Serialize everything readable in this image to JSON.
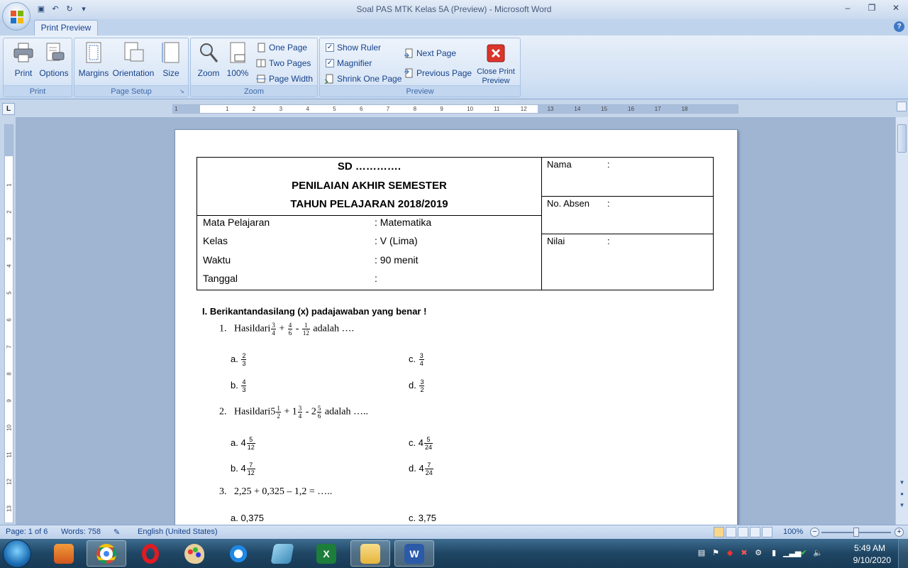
{
  "window": {
    "title": "Soal PAS MTK Kelas 5A (Preview) - Microsoft Word",
    "minimize": "‒",
    "restore": "❐",
    "close": "✕"
  },
  "qat": {
    "save": "▣",
    "undo": "↶",
    "redo": "↻",
    "customize": "▾"
  },
  "tabs": {
    "active": "Print Preview",
    "help": "?"
  },
  "ribbon": {
    "print_group": {
      "label": "Print",
      "print": "Print",
      "options": "Options"
    },
    "page_setup_group": {
      "label": "Page Setup",
      "margins": "Margins",
      "orientation": "Orientation",
      "size": "Size"
    },
    "zoom_group": {
      "label": "Zoom",
      "zoom": "Zoom",
      "zoom100": "100%",
      "one_page": "One Page",
      "two_pages": "Two Pages",
      "page_width": "Page Width"
    },
    "preview_group": {
      "label": "Preview",
      "show_ruler": "Show Ruler",
      "show_ruler_checked": true,
      "magnifier": "Magnifier",
      "magnifier_checked": true,
      "shrink_one_page": "Shrink One Page",
      "next_page": "Next Page",
      "previous_page": "Previous Page",
      "close_line1": "Close Print",
      "close_line2": "Preview"
    }
  },
  "ruler": {
    "corner": "L",
    "h_ticks": [
      "1",
      "1",
      "2",
      "3",
      "4",
      "5",
      "6",
      "7",
      "8",
      "9",
      "10",
      "11",
      "12",
      "13",
      "14",
      "15",
      "16",
      "17",
      "18"
    ],
    "v_ticks": [
      "1",
      "2",
      "3",
      "4",
      "5",
      "6",
      "7",
      "8",
      "9",
      "10",
      "11",
      "12",
      "13"
    ]
  },
  "document": {
    "header": {
      "school": "SD ………….",
      "title1": "PENILAIAN AKHIR SEMESTER",
      "title2": "TAHUN PELAJARAN 2018/2019"
    },
    "info": [
      {
        "label": "Mata Pelajaran",
        "value": ": Matematika"
      },
      {
        "label": "Kelas",
        "value": ": V (Lima)"
      },
      {
        "label": "Waktu",
        "value": ": 90 menit"
      },
      {
        "label": "Tanggal",
        "value": ":"
      }
    ],
    "side": [
      {
        "label": "Nama",
        "colon": ":"
      },
      {
        "label": "No. Absen",
        "colon": ":"
      },
      {
        "label": "Nilai",
        "colon": ":"
      }
    ],
    "section": "I.   Berikantandasilang (x) padajawaban yang benar !",
    "q1": {
      "num": "1.",
      "prefix": "Hasildari",
      "f1": [
        "3",
        "4"
      ],
      "op1": "+",
      "f2": [
        "4",
        "6"
      ],
      "op2": "-",
      "f3": [
        "1",
        "12"
      ],
      "suffix": "adalah ….",
      "a": {
        "letter": "a.",
        "frac": [
          "2",
          "3"
        ]
      },
      "b": {
        "letter": "b.",
        "frac": [
          "4",
          "3"
        ]
      },
      "c": {
        "letter": "c.",
        "frac": [
          "3",
          "4"
        ]
      },
      "d": {
        "letter": "d.",
        "frac": [
          "3",
          "2"
        ]
      }
    },
    "q2": {
      "num": "2.",
      "prefix": "Hasildari",
      "w1": "5",
      "f1": [
        "1",
        "2"
      ],
      "op1": "+",
      "w2": "1",
      "f2": [
        "3",
        "4"
      ],
      "op2": "-",
      "w3": "2",
      "f3": [
        "5",
        "6"
      ],
      "suffix": "adalah …..",
      "a": {
        "letter": "a.",
        "whole": "4",
        "frac": [
          "5",
          "12"
        ]
      },
      "b": {
        "letter": "b.",
        "whole": "4",
        "frac": [
          "7",
          "12"
        ]
      },
      "c": {
        "letter": "c.",
        "whole": "4",
        "frac": [
          "5",
          "24"
        ]
      },
      "d": {
        "letter": "d.",
        "whole": "4",
        "frac": [
          "7",
          "24"
        ]
      }
    },
    "q3": {
      "num": "3.",
      "text": "2,25 + 0,325 – 1,2 = …..",
      "a": "a.  0,375",
      "c": "c.  3,75"
    }
  },
  "status": {
    "page": "Page: 1 of 6",
    "words": "Words: 758",
    "language": "English (United States)",
    "zoom": "100%",
    "zoom_out": "−",
    "zoom_in": "+"
  },
  "tray": {
    "time": "5:49 AM",
    "date": "9/10/2020"
  }
}
